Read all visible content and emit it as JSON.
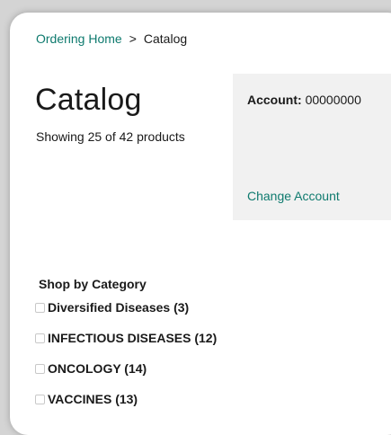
{
  "breadcrumb": {
    "home_label": "Ordering Home",
    "separator": ">",
    "current_label": "Catalog"
  },
  "page": {
    "title": "Catalog",
    "count_text": "Showing 25 of 42 products"
  },
  "account": {
    "label": "Account:",
    "number": "00000000",
    "change_label": "Change Account"
  },
  "categories": {
    "heading": "Shop by Category",
    "items": [
      {
        "label": "Diversified Diseases  (3)",
        "checked": false
      },
      {
        "label": "INFECTIOUS DISEASES  (12)",
        "checked": false
      },
      {
        "label": "ONCOLOGY  (14)",
        "checked": false
      },
      {
        "label": "VACCINES  (13)",
        "checked": false
      }
    ]
  },
  "colors": {
    "accent": "#0e7a6e",
    "panel": "#f1f1f1",
    "text": "#1a1a1a"
  }
}
